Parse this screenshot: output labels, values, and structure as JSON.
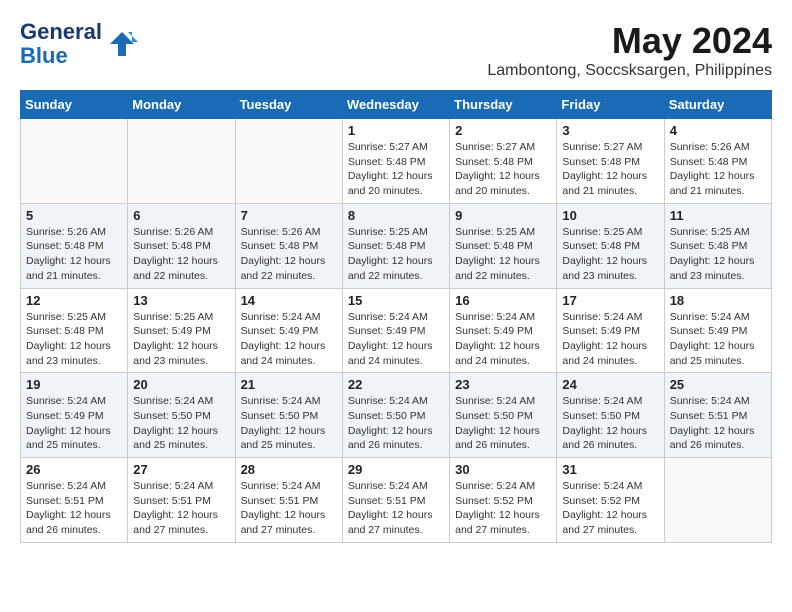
{
  "header": {
    "logo_line1": "General",
    "logo_line2": "Blue",
    "month_year": "May 2024",
    "location": "Lambontong, Soccsksargen, Philippines"
  },
  "days_of_week": [
    "Sunday",
    "Monday",
    "Tuesday",
    "Wednesday",
    "Thursday",
    "Friday",
    "Saturday"
  ],
  "weeks": [
    [
      {
        "day": "",
        "info": ""
      },
      {
        "day": "",
        "info": ""
      },
      {
        "day": "",
        "info": ""
      },
      {
        "day": "1",
        "info": "Sunrise: 5:27 AM\nSunset: 5:48 PM\nDaylight: 12 hours\nand 20 minutes."
      },
      {
        "day": "2",
        "info": "Sunrise: 5:27 AM\nSunset: 5:48 PM\nDaylight: 12 hours\nand 20 minutes."
      },
      {
        "day": "3",
        "info": "Sunrise: 5:27 AM\nSunset: 5:48 PM\nDaylight: 12 hours\nand 21 minutes."
      },
      {
        "day": "4",
        "info": "Sunrise: 5:26 AM\nSunset: 5:48 PM\nDaylight: 12 hours\nand 21 minutes."
      }
    ],
    [
      {
        "day": "5",
        "info": "Sunrise: 5:26 AM\nSunset: 5:48 PM\nDaylight: 12 hours\nand 21 minutes."
      },
      {
        "day": "6",
        "info": "Sunrise: 5:26 AM\nSunset: 5:48 PM\nDaylight: 12 hours\nand 22 minutes."
      },
      {
        "day": "7",
        "info": "Sunrise: 5:26 AM\nSunset: 5:48 PM\nDaylight: 12 hours\nand 22 minutes."
      },
      {
        "day": "8",
        "info": "Sunrise: 5:25 AM\nSunset: 5:48 PM\nDaylight: 12 hours\nand 22 minutes."
      },
      {
        "day": "9",
        "info": "Sunrise: 5:25 AM\nSunset: 5:48 PM\nDaylight: 12 hours\nand 22 minutes."
      },
      {
        "day": "10",
        "info": "Sunrise: 5:25 AM\nSunset: 5:48 PM\nDaylight: 12 hours\nand 23 minutes."
      },
      {
        "day": "11",
        "info": "Sunrise: 5:25 AM\nSunset: 5:48 PM\nDaylight: 12 hours\nand 23 minutes."
      }
    ],
    [
      {
        "day": "12",
        "info": "Sunrise: 5:25 AM\nSunset: 5:48 PM\nDaylight: 12 hours\nand 23 minutes."
      },
      {
        "day": "13",
        "info": "Sunrise: 5:25 AM\nSunset: 5:49 PM\nDaylight: 12 hours\nand 23 minutes."
      },
      {
        "day": "14",
        "info": "Sunrise: 5:24 AM\nSunset: 5:49 PM\nDaylight: 12 hours\nand 24 minutes."
      },
      {
        "day": "15",
        "info": "Sunrise: 5:24 AM\nSunset: 5:49 PM\nDaylight: 12 hours\nand 24 minutes."
      },
      {
        "day": "16",
        "info": "Sunrise: 5:24 AM\nSunset: 5:49 PM\nDaylight: 12 hours\nand 24 minutes."
      },
      {
        "day": "17",
        "info": "Sunrise: 5:24 AM\nSunset: 5:49 PM\nDaylight: 12 hours\nand 24 minutes."
      },
      {
        "day": "18",
        "info": "Sunrise: 5:24 AM\nSunset: 5:49 PM\nDaylight: 12 hours\nand 25 minutes."
      }
    ],
    [
      {
        "day": "19",
        "info": "Sunrise: 5:24 AM\nSunset: 5:49 PM\nDaylight: 12 hours\nand 25 minutes."
      },
      {
        "day": "20",
        "info": "Sunrise: 5:24 AM\nSunset: 5:50 PM\nDaylight: 12 hours\nand 25 minutes."
      },
      {
        "day": "21",
        "info": "Sunrise: 5:24 AM\nSunset: 5:50 PM\nDaylight: 12 hours\nand 25 minutes."
      },
      {
        "day": "22",
        "info": "Sunrise: 5:24 AM\nSunset: 5:50 PM\nDaylight: 12 hours\nand 26 minutes."
      },
      {
        "day": "23",
        "info": "Sunrise: 5:24 AM\nSunset: 5:50 PM\nDaylight: 12 hours\nand 26 minutes."
      },
      {
        "day": "24",
        "info": "Sunrise: 5:24 AM\nSunset: 5:50 PM\nDaylight: 12 hours\nand 26 minutes."
      },
      {
        "day": "25",
        "info": "Sunrise: 5:24 AM\nSunset: 5:51 PM\nDaylight: 12 hours\nand 26 minutes."
      }
    ],
    [
      {
        "day": "26",
        "info": "Sunrise: 5:24 AM\nSunset: 5:51 PM\nDaylight: 12 hours\nand 26 minutes."
      },
      {
        "day": "27",
        "info": "Sunrise: 5:24 AM\nSunset: 5:51 PM\nDaylight: 12 hours\nand 27 minutes."
      },
      {
        "day": "28",
        "info": "Sunrise: 5:24 AM\nSunset: 5:51 PM\nDaylight: 12 hours\nand 27 minutes."
      },
      {
        "day": "29",
        "info": "Sunrise: 5:24 AM\nSunset: 5:51 PM\nDaylight: 12 hours\nand 27 minutes."
      },
      {
        "day": "30",
        "info": "Sunrise: 5:24 AM\nSunset: 5:52 PM\nDaylight: 12 hours\nand 27 minutes."
      },
      {
        "day": "31",
        "info": "Sunrise: 5:24 AM\nSunset: 5:52 PM\nDaylight: 12 hours\nand 27 minutes."
      },
      {
        "day": "",
        "info": ""
      }
    ]
  ]
}
